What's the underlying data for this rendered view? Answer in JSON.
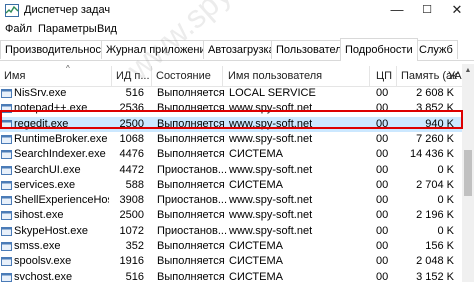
{
  "window": {
    "title": "Диспетчер задач",
    "minimize": "—",
    "maximize": "☐",
    "close": "✕"
  },
  "menu": [
    "Файл",
    "Параметры",
    "Вид"
  ],
  "tabs": [
    "Производительность",
    "Журнал приложений",
    "Автозагрузка",
    "Пользователи",
    "Подробности",
    "Служб"
  ],
  "active_tab": "Подробности",
  "columns": [
    "Имя",
    "ИД п...",
    "Состояние",
    "Имя пользователя",
    "ЦП",
    "Память (акт...",
    "УАС"
  ],
  "rows": [
    {
      "name": "NisSrv.exe",
      "pid": "516",
      "state": "Выполняется",
      "user": "LOCAL SERVICE",
      "cpu": "00",
      "mem": "2 608 K"
    },
    {
      "name": "notepad++.exe",
      "pid": "2536",
      "state": "Выполняется",
      "user": "www.spy-soft.net",
      "cpu": "00",
      "mem": "3 852 K"
    },
    {
      "name": "regedit.exe",
      "pid": "2500",
      "state": "Выполняется",
      "user": "www.spy-soft.net",
      "cpu": "00",
      "mem": "940 K"
    },
    {
      "name": "RuntimeBroker.exe",
      "pid": "1068",
      "state": "Выполняется",
      "user": "www.spy-soft.net",
      "cpu": "00",
      "mem": "7 260 K"
    },
    {
      "name": "SearchIndexer.exe",
      "pid": "4476",
      "state": "Выполняется",
      "user": "СИСТЕМА",
      "cpu": "00",
      "mem": "14 436 K"
    },
    {
      "name": "SearchUI.exe",
      "pid": "4472",
      "state": "Приостанов...",
      "user": "www.spy-soft.net",
      "cpu": "00",
      "mem": "0 K"
    },
    {
      "name": "services.exe",
      "pid": "588",
      "state": "Выполняется",
      "user": "СИСТЕМА",
      "cpu": "00",
      "mem": "2 704 K"
    },
    {
      "name": "ShellExperienceHost...",
      "pid": "3908",
      "state": "Приостанов...",
      "user": "www.spy-soft.net",
      "cpu": "00",
      "mem": "0 K"
    },
    {
      "name": "sihost.exe",
      "pid": "2500",
      "state": "Выполняется",
      "user": "www.spy-soft.net",
      "cpu": "00",
      "mem": "2 196 K"
    },
    {
      "name": "SkypeHost.exe",
      "pid": "1072",
      "state": "Приостанов...",
      "user": "www.spy-soft.net",
      "cpu": "00",
      "mem": "0 K"
    },
    {
      "name": "smss.exe",
      "pid": "352",
      "state": "Выполняется",
      "user": "СИСТЕМА",
      "cpu": "00",
      "mem": "156 K"
    },
    {
      "name": "spoolsv.exe",
      "pid": "1916",
      "state": "Выполняется",
      "user": "СИСТЕМА",
      "cpu": "00",
      "mem": "2 048 K"
    },
    {
      "name": "svchost.exe",
      "pid": "516",
      "state": "Выполняется",
      "user": "СИСТЕМА",
      "cpu": "00",
      "mem": "3 152 K"
    }
  ],
  "selected_row": "regedit.exe",
  "watermark": "www.spy-soft.net",
  "colors": {
    "selection": "#cce8ff",
    "highlight_border": "#dd0000"
  }
}
